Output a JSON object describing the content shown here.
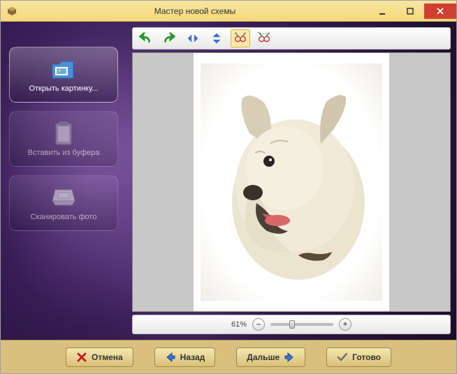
{
  "window": {
    "title": "Мастер новой схемы"
  },
  "sidebar": {
    "items": [
      {
        "label": "Открыть картинку...",
        "icon": "folder-image-icon",
        "enabled": true
      },
      {
        "label": "Вставить из буфера",
        "icon": "clipboard-icon",
        "enabled": false
      },
      {
        "label": "Сканировать фото",
        "icon": "scanner-icon",
        "enabled": false
      }
    ]
  },
  "toolbar": {
    "tools": [
      {
        "name": "rotate-left-icon",
        "active": false
      },
      {
        "name": "rotate-right-icon",
        "active": false
      },
      {
        "name": "flip-horizontal-icon",
        "active": false
      },
      {
        "name": "flip-vertical-icon",
        "active": false
      },
      {
        "name": "crop-icon",
        "active": true
      },
      {
        "name": "cut-icon",
        "active": false
      }
    ]
  },
  "canvas": {
    "subject": "dog"
  },
  "zoom": {
    "label": "61%",
    "minus": "–",
    "plus": "+"
  },
  "footer": {
    "cancel": "Отмена",
    "back": "Назад",
    "next": "Дальше",
    "finish": "Готово"
  },
  "colors": {
    "accent": "#f5d87a",
    "close": "#d04030"
  }
}
